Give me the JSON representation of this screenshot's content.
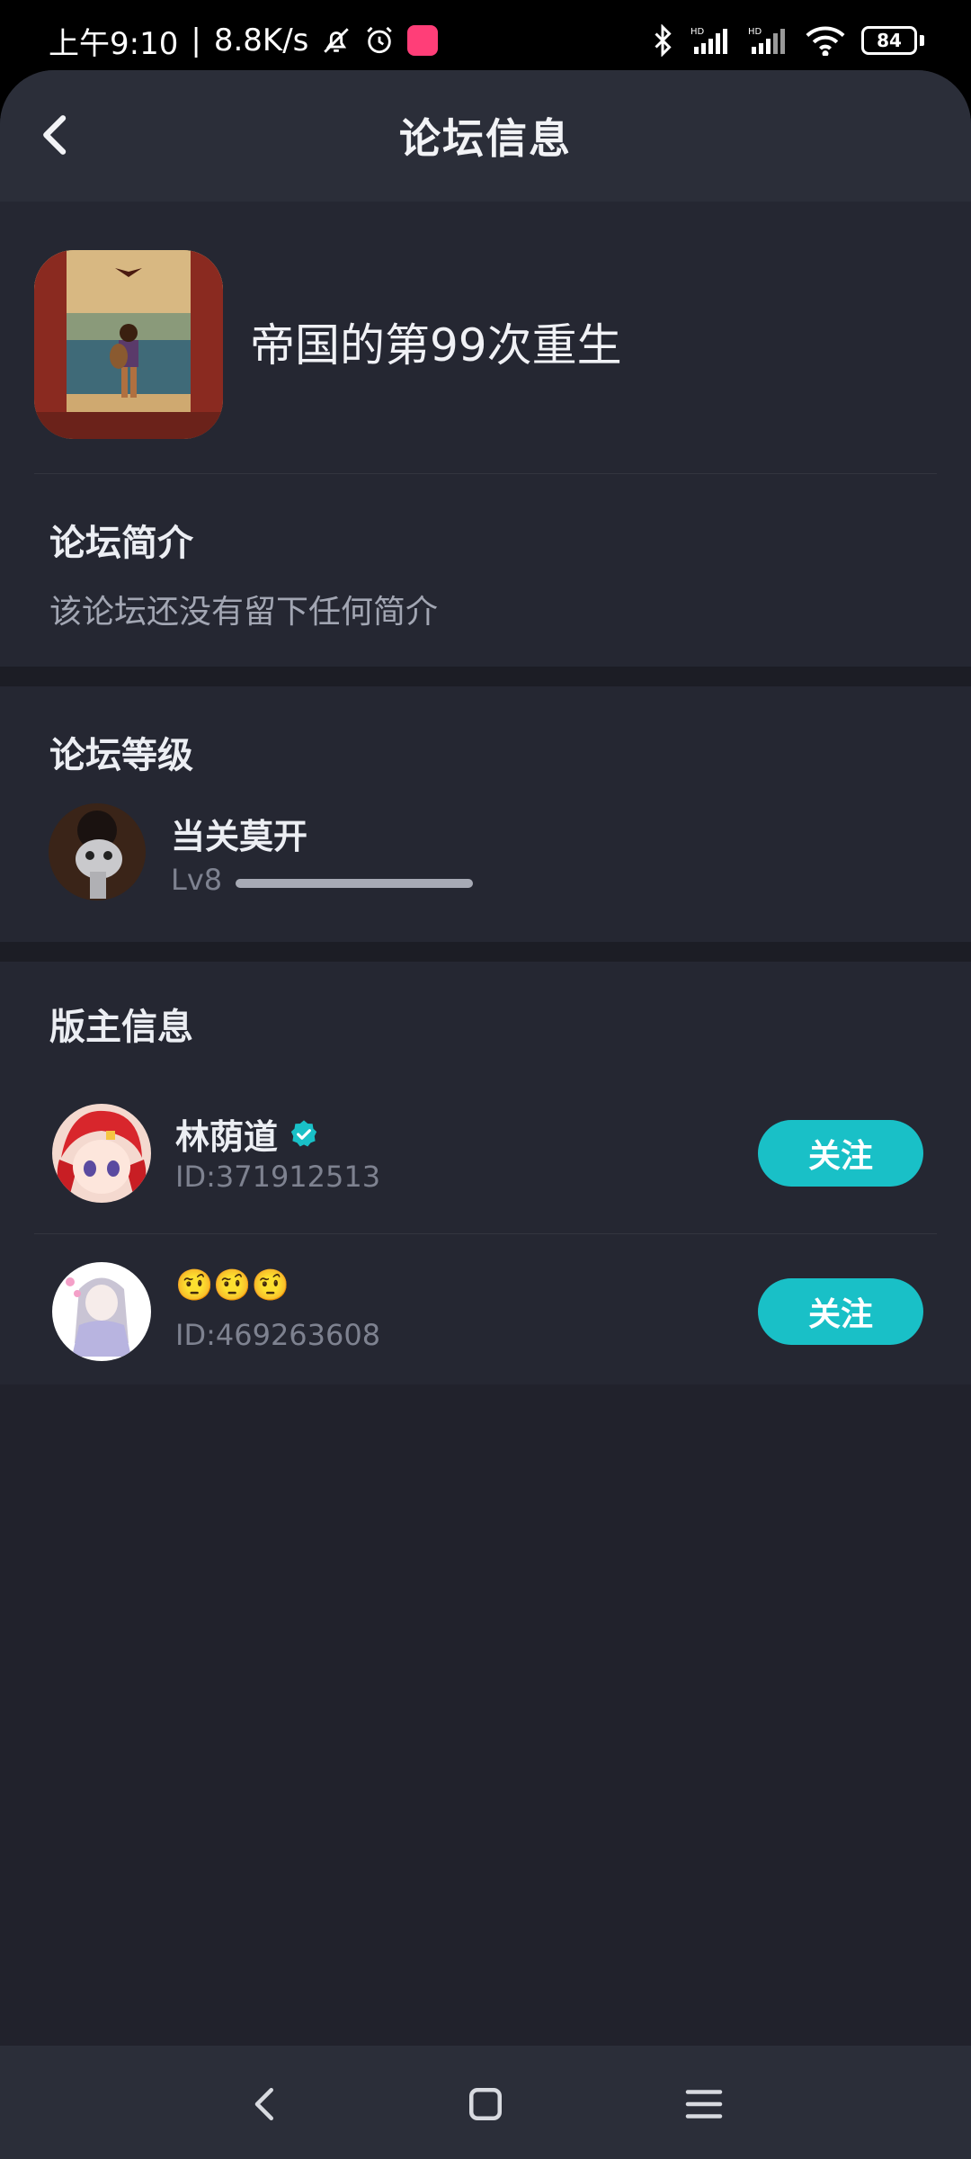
{
  "status_bar": {
    "time": "上午9:10",
    "speed": "8.8K/s",
    "battery": "84",
    "icons": [
      "bell-off-icon",
      "alarm-icon",
      "app-icon",
      "bluetooth-icon",
      "signal-hd-icon",
      "signal-hd-icon",
      "wifi-icon",
      "battery-icon"
    ]
  },
  "header": {
    "title": "论坛信息",
    "back_icon": "chevron-left-icon"
  },
  "forum": {
    "name": "帝国的第99次重生"
  },
  "intro": {
    "title": "论坛简介",
    "text": "该论坛还没有留下任何简介"
  },
  "level": {
    "title": "论坛等级",
    "rank_name": "当关莫开",
    "level_label": "Lv8",
    "progress": 1.0
  },
  "moderators": {
    "title": "版主信息",
    "items": [
      {
        "name": "林荫道",
        "id": "ID:371912513",
        "follow_label": "关注",
        "verified": true
      },
      {
        "name": "🤨🤨🤨",
        "id": "ID:469263608",
        "follow_label": "关注",
        "verified": false
      }
    ]
  },
  "nav": {
    "back_icon": "back-icon",
    "home_icon": "home-icon",
    "menu_icon": "menu-icon"
  },
  "colors": {
    "accent": "#19c0c7",
    "background": "#21222c",
    "header": "#2b2e39"
  }
}
